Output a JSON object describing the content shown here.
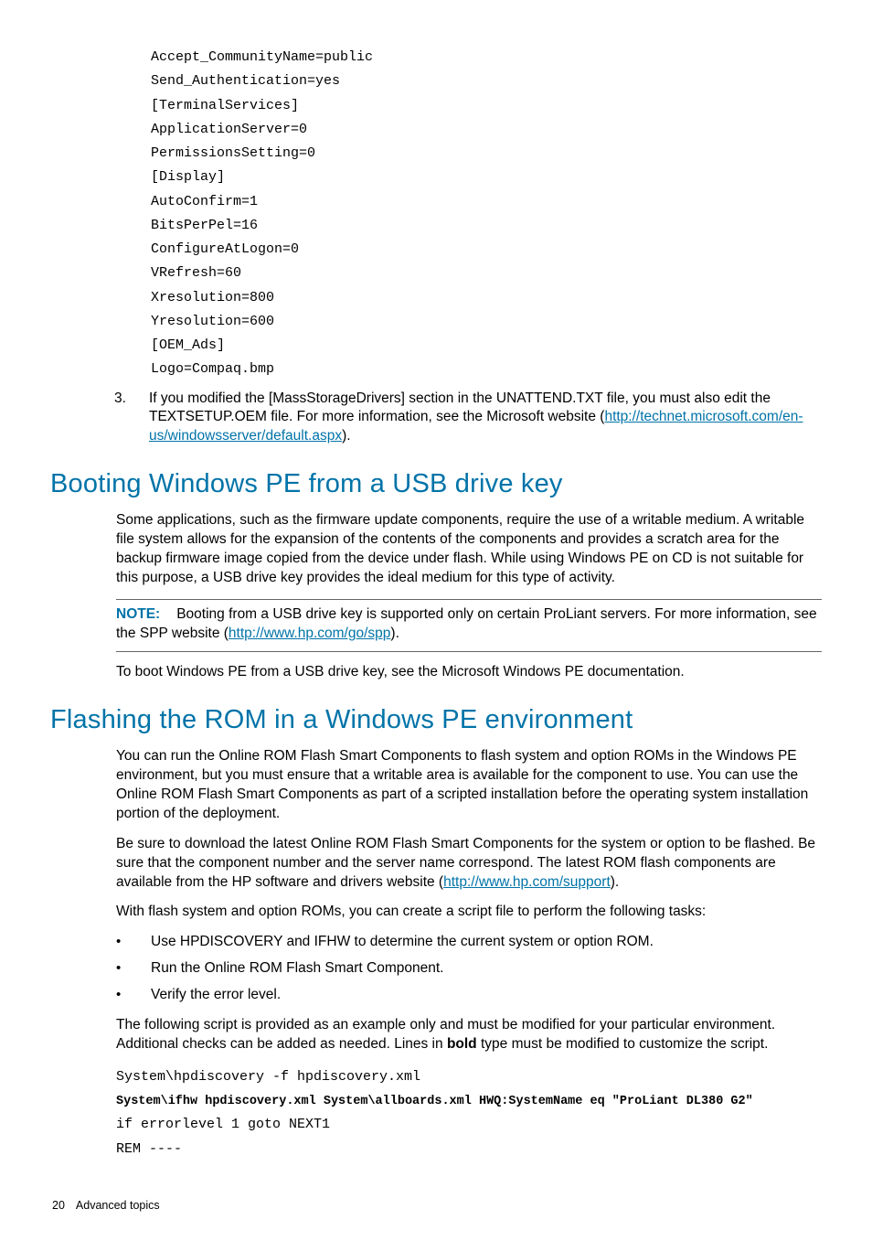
{
  "code_top": "Accept_CommunityName=public\nSend_Authentication=yes\n[TerminalServices]\nApplicationServer=0\nPermissionsSetting=0\n[Display]\nAutoConfirm=1\nBitsPerPel=16\nConfigureAtLogon=0\nVRefresh=60\nXresolution=800\nYresolution=600\n[OEM_Ads]\nLogo=Compaq.bmp",
  "step3_num": "3.",
  "step3_a": "If you modified the [MassStorageDrivers] section in the UNATTEND.TXT file, you must also edit the TEXTSETUP.OEM file. For more information, see the Microsoft website (",
  "step3_link": "http://technet.microsoft.com/en-us/windowsserver/default.aspx",
  "step3_b": ").",
  "heading1": "Booting Windows PE from a USB drive key",
  "para1": "Some applications, such as the firmware update components, require the use of a writable medium. A writable file system allows for the expansion of the contents of the components and provides a scratch area for the backup firmware image copied from the device under flash. While using Windows PE on CD is not suitable for this purpose, a USB drive key provides the ideal medium for this type of activity.",
  "note_label": "NOTE:",
  "note_a": "Booting from a USB drive key is supported only on certain ProLiant servers. For more information, see the SPP website (",
  "note_link": "http://www.hp.com/go/spp",
  "note_b": ").",
  "para2": "To boot Windows PE from a USB drive key, see the Microsoft Windows PE documentation.",
  "heading2": "Flashing the ROM in a Windows PE environment",
  "para3": "You can run the Online ROM Flash Smart Components to flash system and option ROMs in the Windows PE environment, but you must ensure that a writable area is available for the component to use. You can use the Online ROM Flash Smart Components as part of a scripted installation before the operating system installation portion of the deployment.",
  "para4_a": "Be sure to download the latest Online ROM Flash Smart Components for the system or option to be flashed. Be sure that the component number and the server name correspond. The latest ROM flash components are available from the HP software and drivers website (",
  "para4_link": "http://www.hp.com/support",
  "para4_b": ").",
  "para5": "With flash system and option ROMs, you can create a script file to perform the following tasks:",
  "bullets": {
    "b1": "Use HPDISCOVERY and IFHW to determine the current system or option ROM.",
    "b2": "Run the Online ROM Flash Smart Component.",
    "b3": "Verify the error level."
  },
  "para6_a": "The following script is provided as an example only and must be modified for your particular environment. Additional checks can be added as needed. Lines in ",
  "para6_bold": "bold",
  "para6_b": " type must be modified to customize the script.",
  "code_bottom": {
    "l1": "System\\hpdiscovery -f hpdiscovery.xml",
    "l2": "System\\ifhw hpdiscovery.xml System\\allboards.xml HWQ:SystemName eq \"ProLiant DL380 G2\"",
    "l3": "if errorlevel 1 goto NEXT1",
    "l4": "REM ----"
  },
  "footer_num": "20",
  "footer_text": "Advanced topics"
}
